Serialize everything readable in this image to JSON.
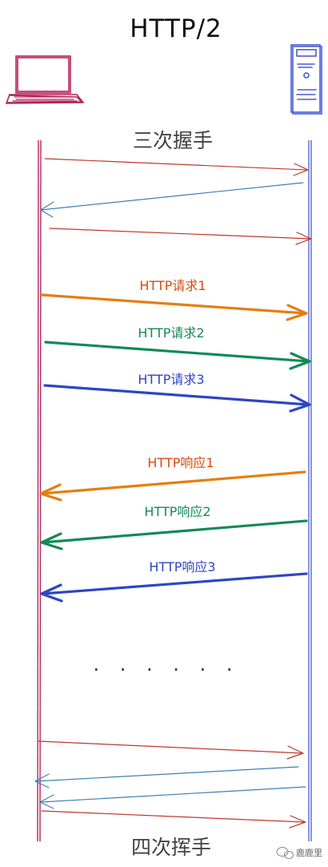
{
  "title": "HTTP/2",
  "actors": {
    "client": {
      "icon": "laptop-icon",
      "color": "#b3245a"
    },
    "server": {
      "icon": "server-icon",
      "color": "#4a5bd0"
    }
  },
  "phases": {
    "handshake": "三次握手",
    "wave": "四次挥手"
  },
  "colors": {
    "thin_to_server": "#c0392b",
    "thin_to_client": "#3f7fb5",
    "req1": "#e67e10",
    "req2": "#138a55",
    "req3": "#2e45c4",
    "resp1_label": "#d9480f",
    "resp2_label": "#138a55",
    "resp3_label": "#2e45c4"
  },
  "messages": {
    "requests": [
      "HTTP请求1",
      "HTTP请求2",
      "HTTP请求3"
    ],
    "responses": [
      "HTTP响应1",
      "HTTP响应2",
      "HTTP响应3"
    ]
  },
  "ellipsis": "· · · · · ·",
  "watermark": "鹿鹿里"
}
